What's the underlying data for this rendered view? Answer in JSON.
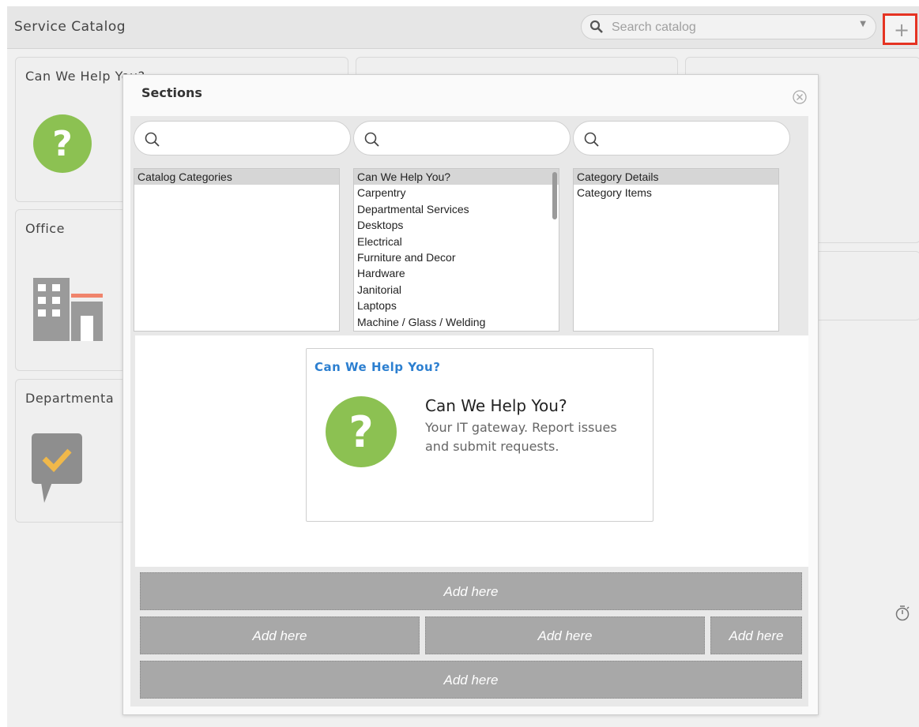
{
  "header": {
    "app_title": "Service Catalog",
    "search_placeholder": "Search catalog",
    "add_button_label": "+"
  },
  "background_cards": [
    {
      "title": "Can We Help You?"
    },
    {
      "title": "Office"
    },
    {
      "title": "Departmenta"
    }
  ],
  "modal": {
    "title": "Sections",
    "columns": [
      {
        "search_value": "",
        "items": [
          "Catalog Categories"
        ],
        "selected_index": 0
      },
      {
        "search_value": "",
        "items": [
          "Can We Help You?",
          "Carpentry",
          "Departmental Services",
          "Desktops",
          "Electrical",
          "Furniture and Decor",
          "Hardware",
          "Janitorial",
          "Laptops",
          "Machine / Glass / Welding"
        ],
        "selected_index": 0
      },
      {
        "search_value": "",
        "items": [
          "Category Details",
          "Category Items"
        ],
        "selected_index": 0
      }
    ],
    "preview": {
      "header": "Can We Help You?",
      "title": "Can We Help You?",
      "description": "Your IT gateway. Report issues and submit requests."
    },
    "drop_zones": {
      "row1": [
        "Add here"
      ],
      "row2": [
        "Add here",
        "Add here",
        "Add here"
      ],
      "row3": [
        "Add here"
      ]
    }
  },
  "colors": {
    "accent_blue": "#2c7fd0",
    "help_green": "#8cc152",
    "highlight_red": "#e53322",
    "dropzone_gray": "#a8a8a8"
  }
}
